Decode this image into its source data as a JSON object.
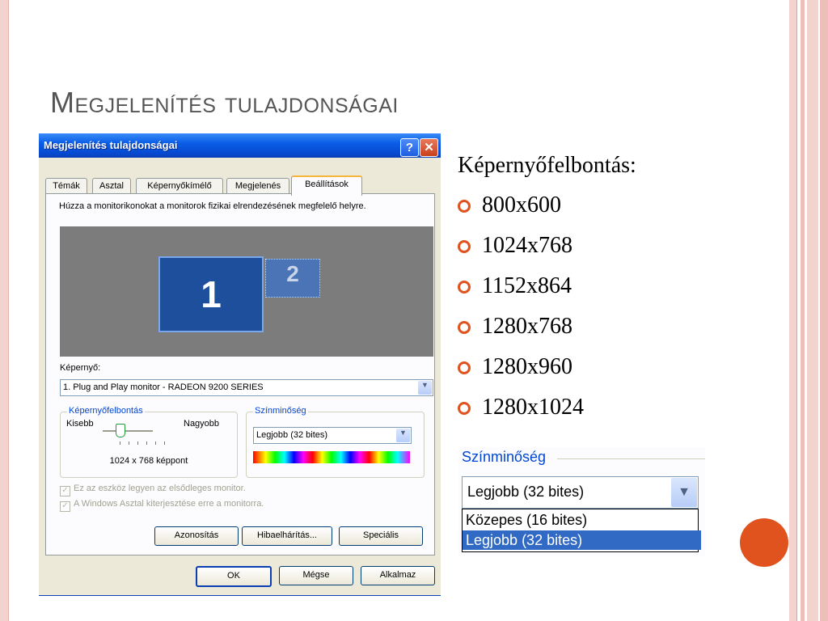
{
  "slide": {
    "title": "Megjelenítés tulajdonságai",
    "accent_color": "#e0531f"
  },
  "dialog": {
    "title": "Megjelenítés tulajdonságai",
    "help_label": "?",
    "close_label": "✕",
    "tabs": [
      {
        "label": "Témák"
      },
      {
        "label": "Asztal"
      },
      {
        "label": "Képernyőkímélő"
      },
      {
        "label": "Megjelenés"
      },
      {
        "label": "Beállítások",
        "active": true
      }
    ],
    "instruction": "Húzza a monitorikonokat a monitorok fizikai elrendezésének megfelelő helyre.",
    "monitors": [
      {
        "label": "1"
      },
      {
        "label": "2"
      }
    ],
    "screen_label": "Képernyő:",
    "screen_value": "1. Plug and Play monitor - RADEON 9200 SERIES",
    "resolution_group": {
      "label": "Képernyőfelbontás",
      "smaller": "Kisebb",
      "larger": "Nagyobb",
      "value_text": "1024 x 768 képpont"
    },
    "color_group": {
      "label": "Színminőség",
      "value": "Legjobb (32 bites)"
    },
    "checkboxes": [
      {
        "label": "Ez az eszköz legyen az elsődleges monitor."
      },
      {
        "label": "A Windows Asztal kiterjesztése erre a monitorra."
      }
    ],
    "buttons": {
      "identify": "Azonosítás",
      "troubleshoot": "Hibaelhárítás...",
      "advanced": "Speciális",
      "ok": "OK",
      "cancel": "Mégse",
      "apply": "Alkalmaz"
    }
  },
  "bullets": {
    "heading": "Képernyőfelbontás:",
    "items": [
      "800x600",
      "1024x768",
      "1152x864",
      "1280x768",
      "1280x960",
      "1280x1024"
    ]
  },
  "inset": {
    "label": "Színminőség",
    "selected": "Legjobb (32 bites)",
    "options": [
      "Közepes (16 bites)",
      "Legjobb (32 bites)"
    ]
  }
}
